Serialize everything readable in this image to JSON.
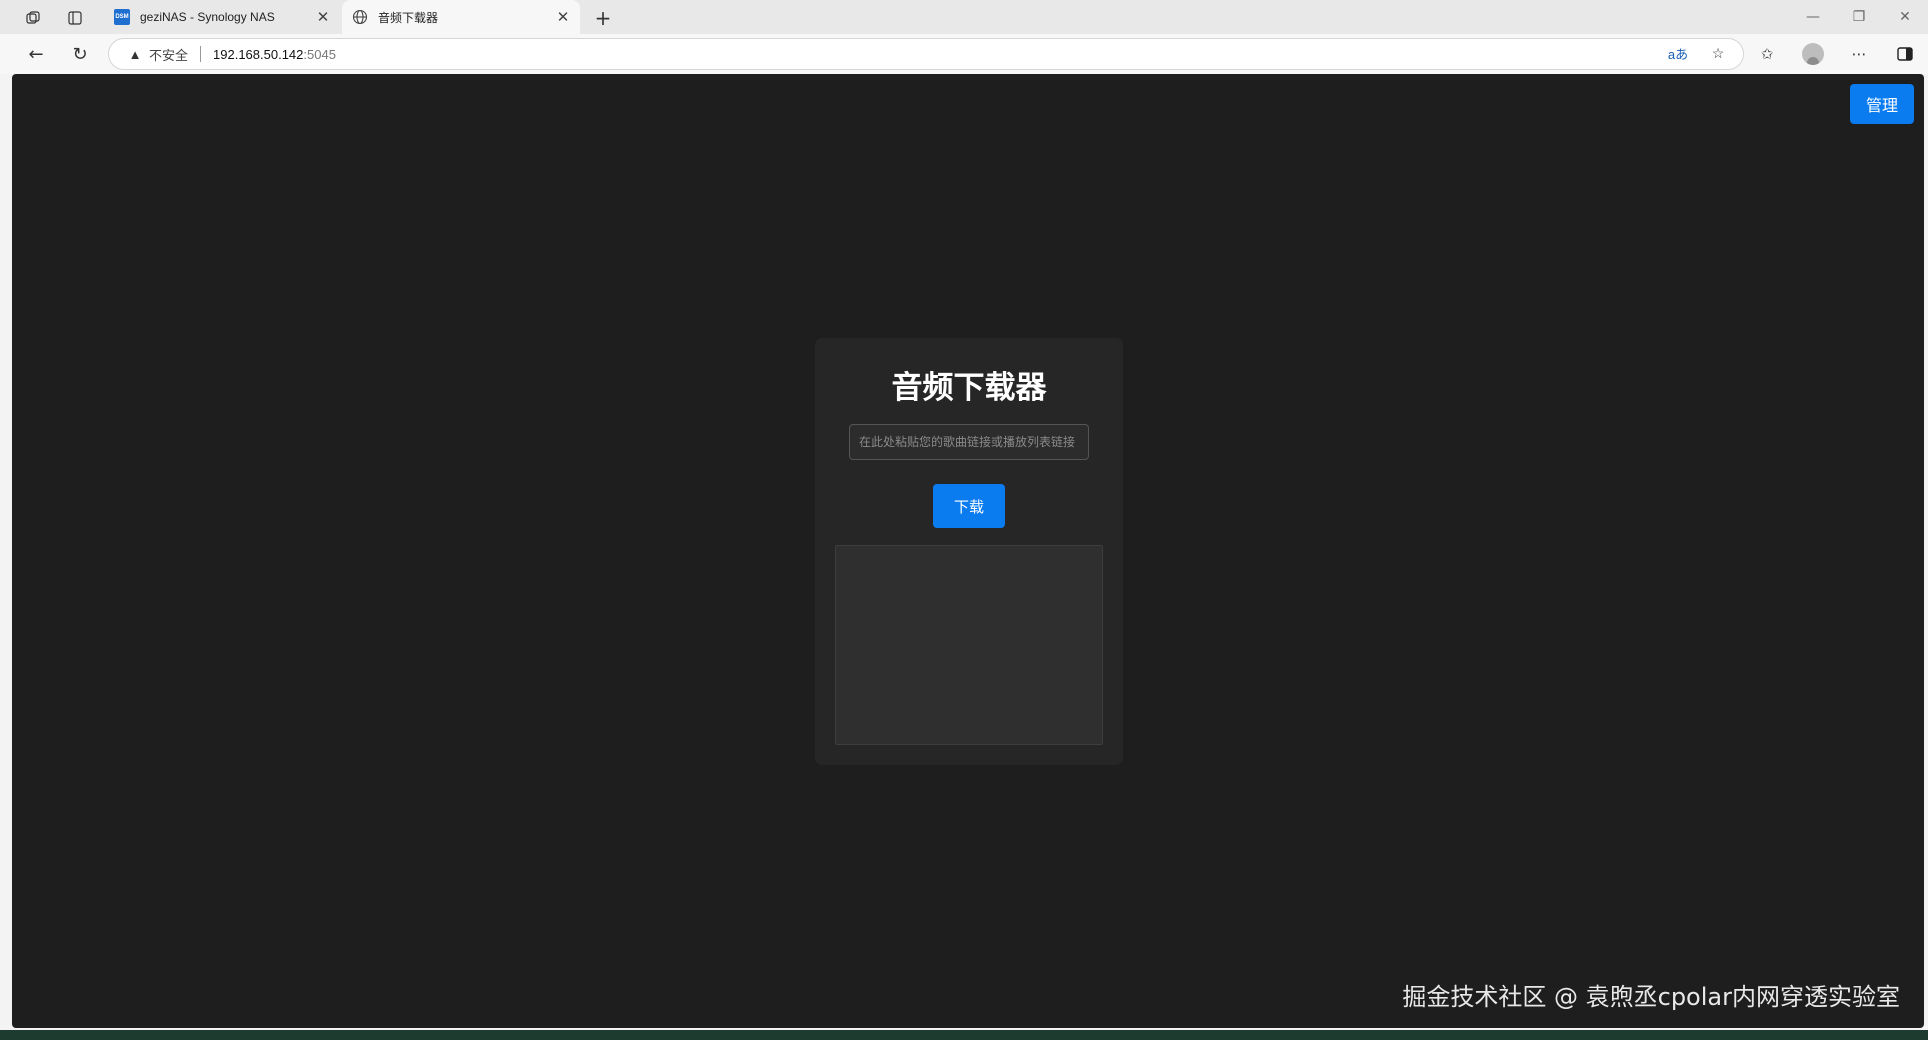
{
  "tabs": [
    {
      "title": "geziNAS - Synology NAS",
      "favicon": "dsm-icon",
      "favicon_text": "DSM",
      "active": false
    },
    {
      "title": "音频下载器",
      "favicon": "globe-icon",
      "active": true
    }
  ],
  "address": {
    "security_label": "不安全",
    "host": "192.168.50.142",
    "port": ":5045"
  },
  "page": {
    "manage_label": "管理",
    "title": "音频下载器",
    "input_placeholder": "在此处粘贴您的歌曲链接或播放列表链接",
    "input_value": "",
    "download_label": "下载",
    "output_text": ""
  },
  "watermark": "掘金技术社区 @ 袁煦丞cpolar内网穿透实验室",
  "colors": {
    "accent": "#0a7cf0",
    "page_bg": "#1e1e1e",
    "card_bg": "#262626"
  }
}
